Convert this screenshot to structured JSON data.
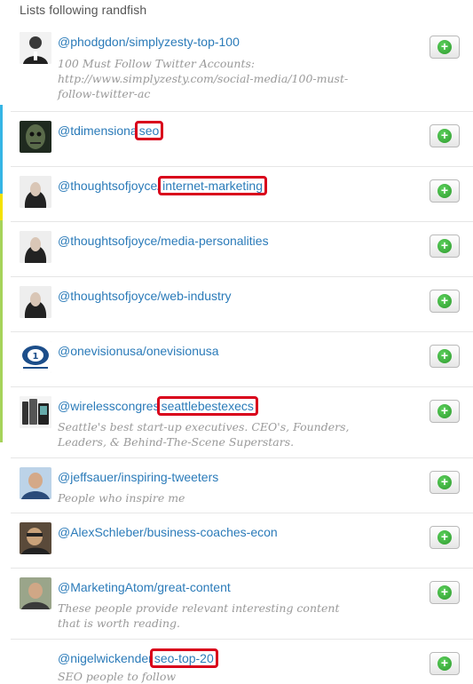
{
  "header": {
    "title": "Lists following randfish"
  },
  "colors": {
    "link": "#2b7bb9",
    "highlight": "#d9001b",
    "plus": "#2e9a2e",
    "desc": "#999999"
  },
  "rows": [
    {
      "prefix": "@phodgdon/simplyzesty-top-100",
      "name": "",
      "description": "100 Must Follow Twitter Accounts: http://www.simplyzesty.com/social-media/100-must-follow-twitter-ac",
      "follow_icon": "plus-icon"
    },
    {
      "prefix": "@tdimensiona",
      "name": "seo",
      "description": "",
      "follow_icon": "plus-icon"
    },
    {
      "prefix": "@thoughtsofjoyce/",
      "name": "internet-marketing",
      "description": "",
      "follow_icon": "plus-icon"
    },
    {
      "prefix": "@thoughtsofjoyce/media-personalities",
      "name": "",
      "description": "",
      "follow_icon": "plus-icon"
    },
    {
      "prefix": "@thoughtsofjoyce/web-industry",
      "name": "",
      "description": "",
      "follow_icon": "plus-icon"
    },
    {
      "prefix": "@onevisionusa/onevisionusa",
      "name": "",
      "description": "",
      "follow_icon": "plus-icon"
    },
    {
      "prefix": "@wirelesscongres",
      "name": "seattlebestexecs",
      "description": "Seattle's best start-up executives. CEO's, Founders, Leaders, & Behind-The-Scene Superstars.",
      "follow_icon": "plus-icon"
    },
    {
      "prefix": "@jeffsauer/inspiring-tweeters",
      "name": "",
      "description": "People who inspire me",
      "follow_icon": "plus-icon"
    },
    {
      "prefix": "@AlexSchleber/business-coaches-econ",
      "name": "",
      "description": "",
      "follow_icon": "plus-icon"
    },
    {
      "prefix": "@MarketingAtom/great-content",
      "name": "",
      "description": "These people provide relevant interesting content that is worth reading.",
      "follow_icon": "plus-icon"
    },
    {
      "prefix": "@nigelwickender",
      "name": "seo-top-20",
      "description": "SEO people to follow",
      "follow_icon": "plus-icon"
    }
  ]
}
